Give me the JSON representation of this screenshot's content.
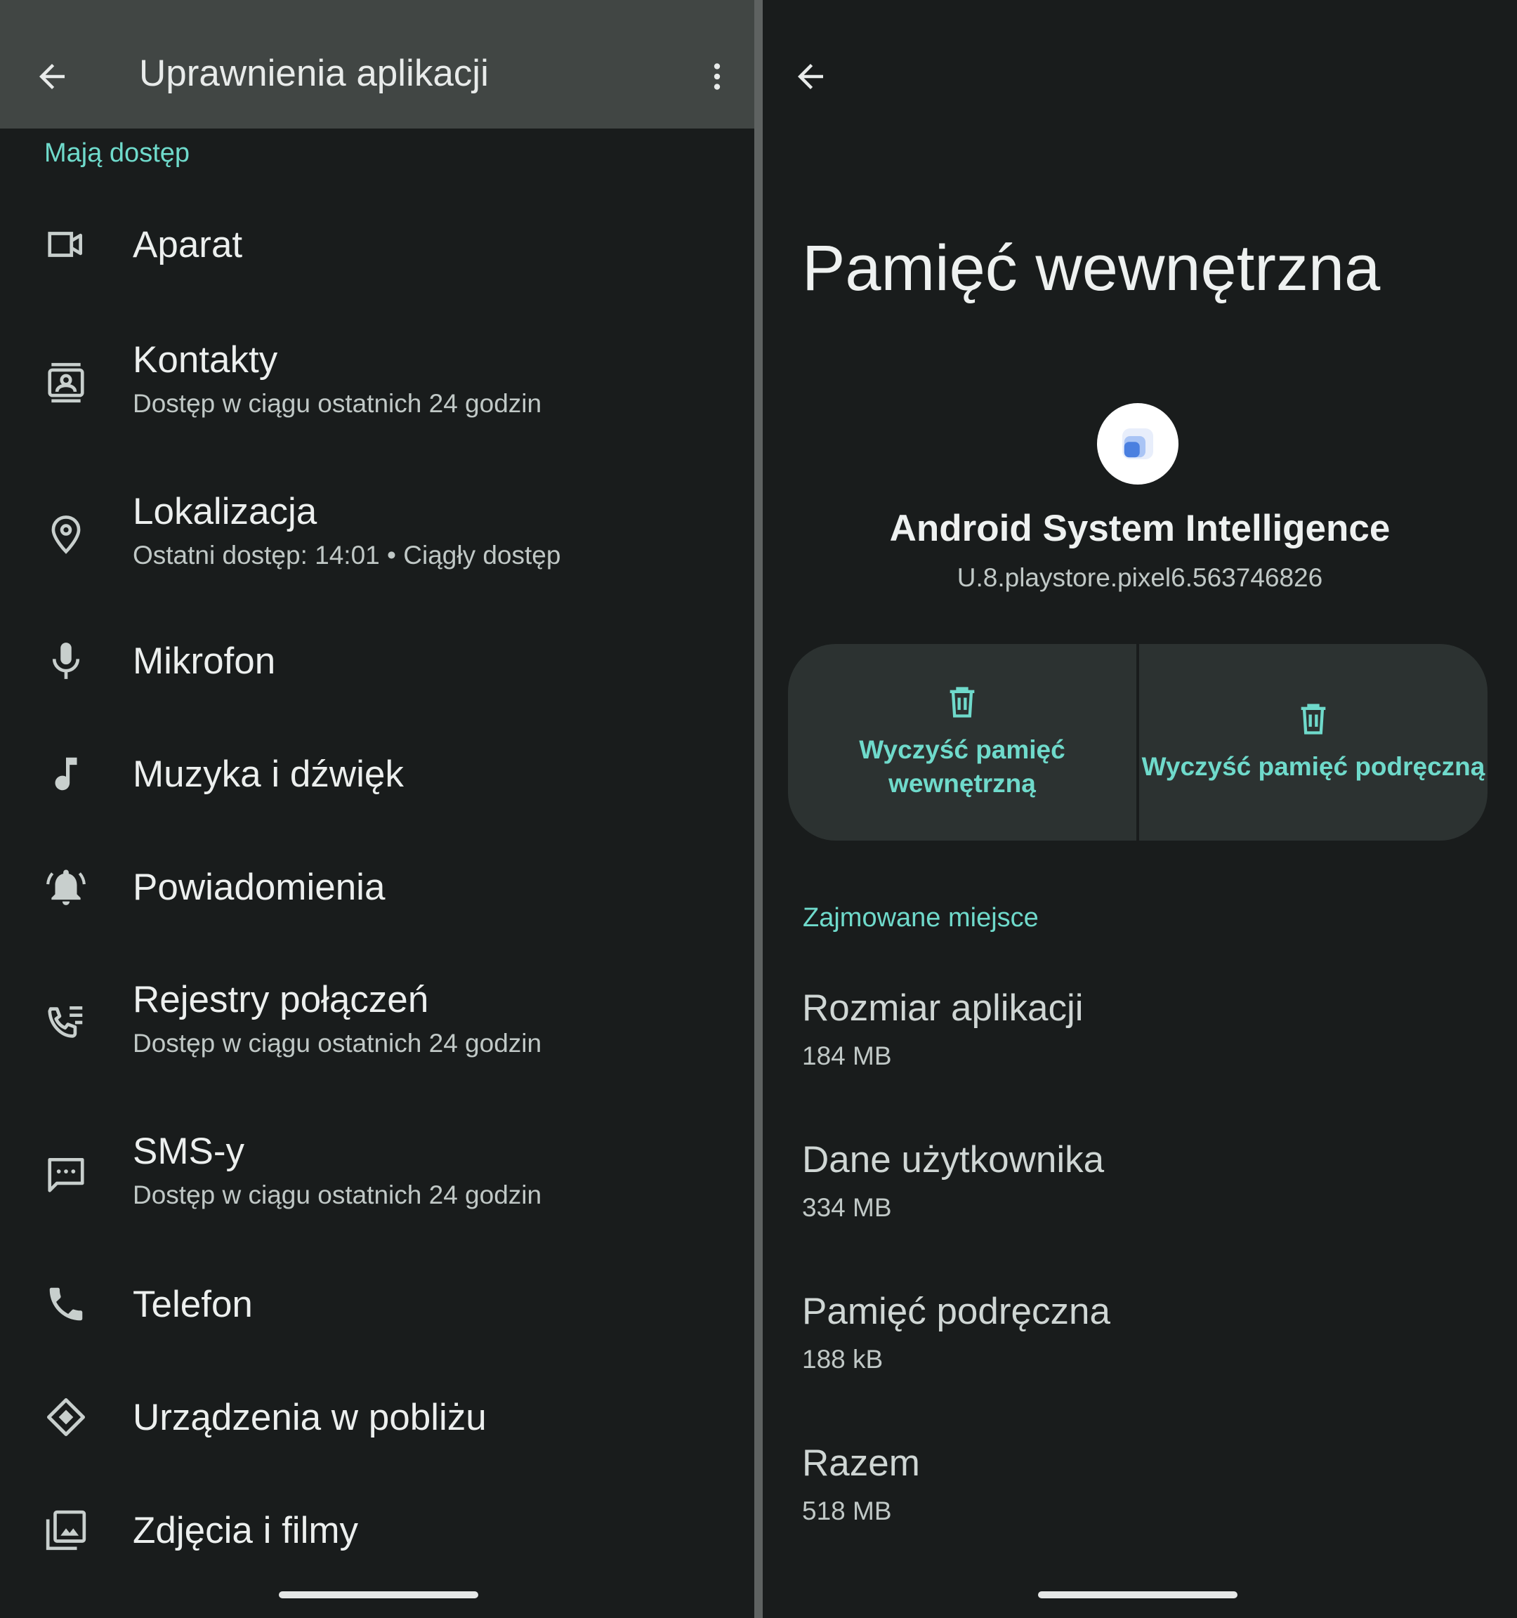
{
  "left_screen": {
    "title": "Uprawnienia aplikacji",
    "section_header": "Mają dostęp",
    "items": [
      {
        "icon": "camera-icon",
        "title": "Aparat",
        "subtitle": ""
      },
      {
        "icon": "contacts-icon",
        "title": "Kontakty",
        "subtitle": "Dostęp w ciągu ostatnich 24 godzin"
      },
      {
        "icon": "location-pin-icon",
        "title": "Lokalizacja",
        "subtitle": "Ostatni dostęp: 14:01 • Ciągły dostęp"
      },
      {
        "icon": "microphone-icon",
        "title": "Mikrofon",
        "subtitle": ""
      },
      {
        "icon": "music-note-icon",
        "title": "Muzyka i dźwięk",
        "subtitle": ""
      },
      {
        "icon": "notification-bell-icon",
        "title": "Powiadomienia",
        "subtitle": ""
      },
      {
        "icon": "call-log-icon",
        "title": "Rejestry połączeń",
        "subtitle": "Dostęp w ciągu ostatnich 24 godzin"
      },
      {
        "icon": "sms-icon",
        "title": "SMS-y",
        "subtitle": "Dostęp w ciągu ostatnich 24 godzin"
      },
      {
        "icon": "phone-icon",
        "title": "Telefon",
        "subtitle": ""
      },
      {
        "icon": "nearby-devices-icon",
        "title": "Urządzenia w pobliżu",
        "subtitle": ""
      },
      {
        "icon": "photos-icon",
        "title": "Zdjęcia i filmy",
        "subtitle": ""
      }
    ]
  },
  "right_screen": {
    "title": "Pamięć wewnętrzna",
    "app": {
      "name": "Android System Intelligence",
      "version": "U.8.playstore.pixel6.563746826"
    },
    "actions": {
      "clear_storage": "Wyczyść pamięć wewnętrzną",
      "clear_cache": "Wyczyść pamięć podręczną"
    },
    "section_header": "Zajmowane miejsce",
    "storage": [
      {
        "label": "Rozmiar aplikacji",
        "value": "184 MB"
      },
      {
        "label": "Dane użytkownika",
        "value": "334 MB"
      },
      {
        "label": "Pamięć podręczna",
        "value": "188 kB"
      },
      {
        "label": "Razem",
        "value": "518 MB"
      }
    ]
  },
  "colors": {
    "background": "#191c1c",
    "app_bar": "#414644",
    "accent": "#6fdacb",
    "panel": "#2c3231"
  }
}
